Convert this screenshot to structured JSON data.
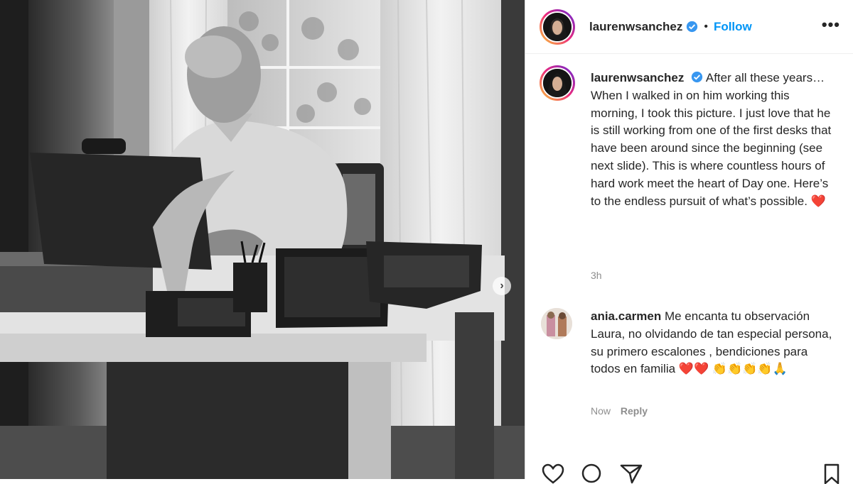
{
  "post": {
    "username": "laurenwsanchez",
    "follow_label": "Follow",
    "separator": "•",
    "more_label": "•••",
    "caption_username": "laurenwsanchez",
    "caption": "After all these years… When I walked in on him working this morning, I took this picture. I just love that he is still working from one of the first desks that have been around since the beginning (see next slide). This is where countless hours of hard work meet the heart of Day one. Here’s to the endless pursuit of what’s possible. ❤️",
    "time": "3h"
  },
  "comment": {
    "username": "ania.carmen",
    "text": "Me encanta tu observación Laura, no olvidando de tan especial persona, su primero escalones , bendiciones para todos en familia ❤️❤️ 👏👏👏👏🙏",
    "time": "Now",
    "reply_label": "Reply"
  },
  "carousel": {
    "next_label": "›"
  },
  "icons": [
    "verified-badge-icon",
    "heart-icon",
    "comment-icon",
    "share-icon",
    "bookmark-icon",
    "chevron-right-icon"
  ],
  "colors": {
    "link": "#0095f6",
    "verified": "#3897f0",
    "heart": "#ed1c24",
    "muted": "#8e8e8e"
  }
}
